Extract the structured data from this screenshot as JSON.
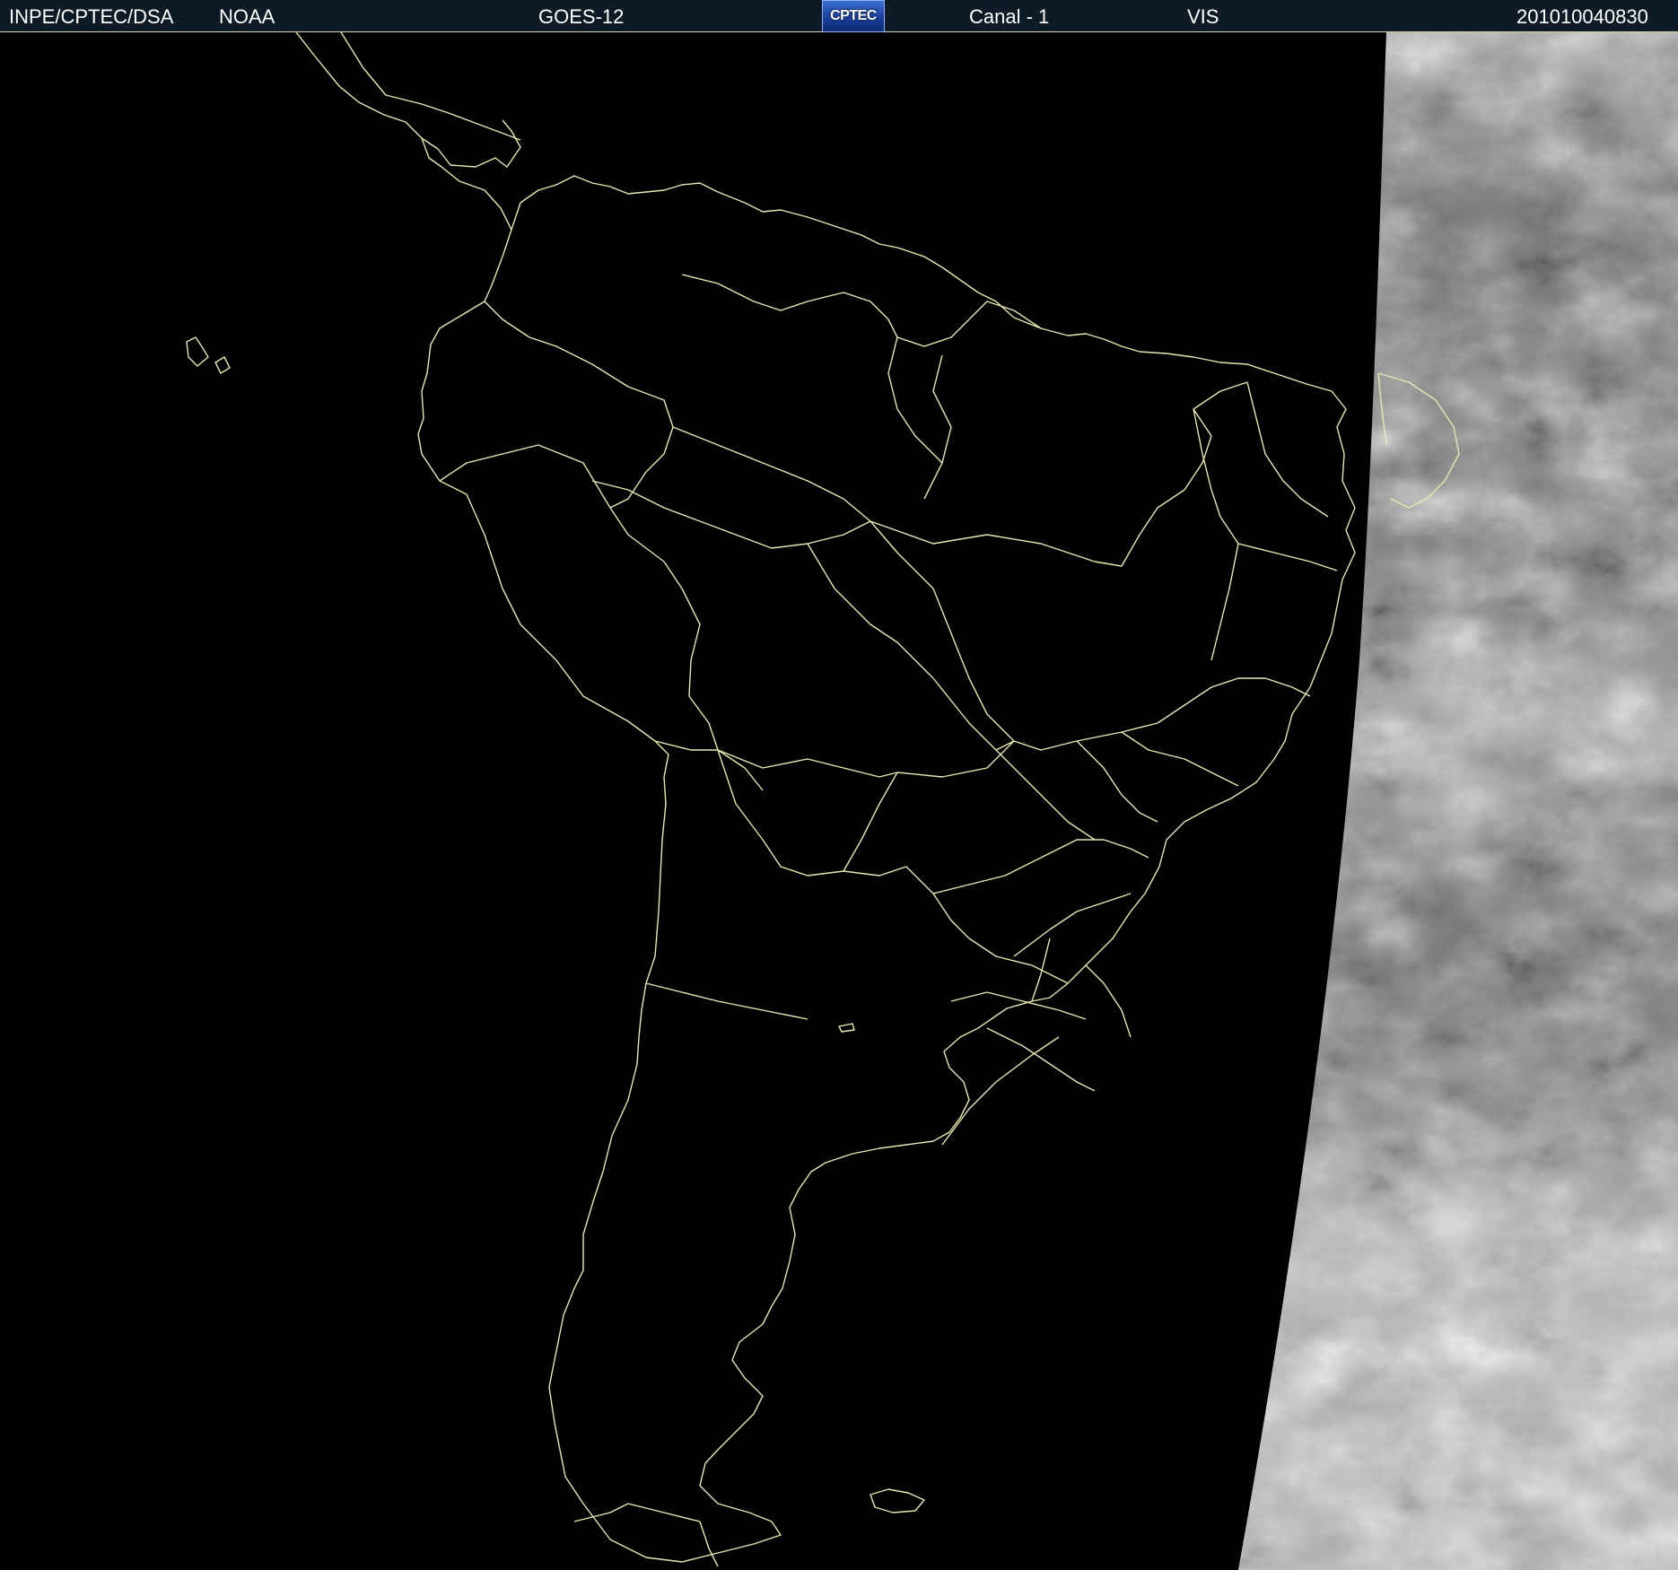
{
  "header": {
    "source": "INPE/CPTEC/DSA",
    "agency": "NOAA",
    "satellite": "GOES-12",
    "logo_text": "CPTEC",
    "channel": "Canal - 1",
    "band": "VIS",
    "timestamp": "201010040830"
  },
  "colors": {
    "header_bg": "#0e1a26",
    "map_bg": "#000000",
    "border_lines": "#e8e8b0",
    "cloud_base": "#8a8a8a"
  }
}
